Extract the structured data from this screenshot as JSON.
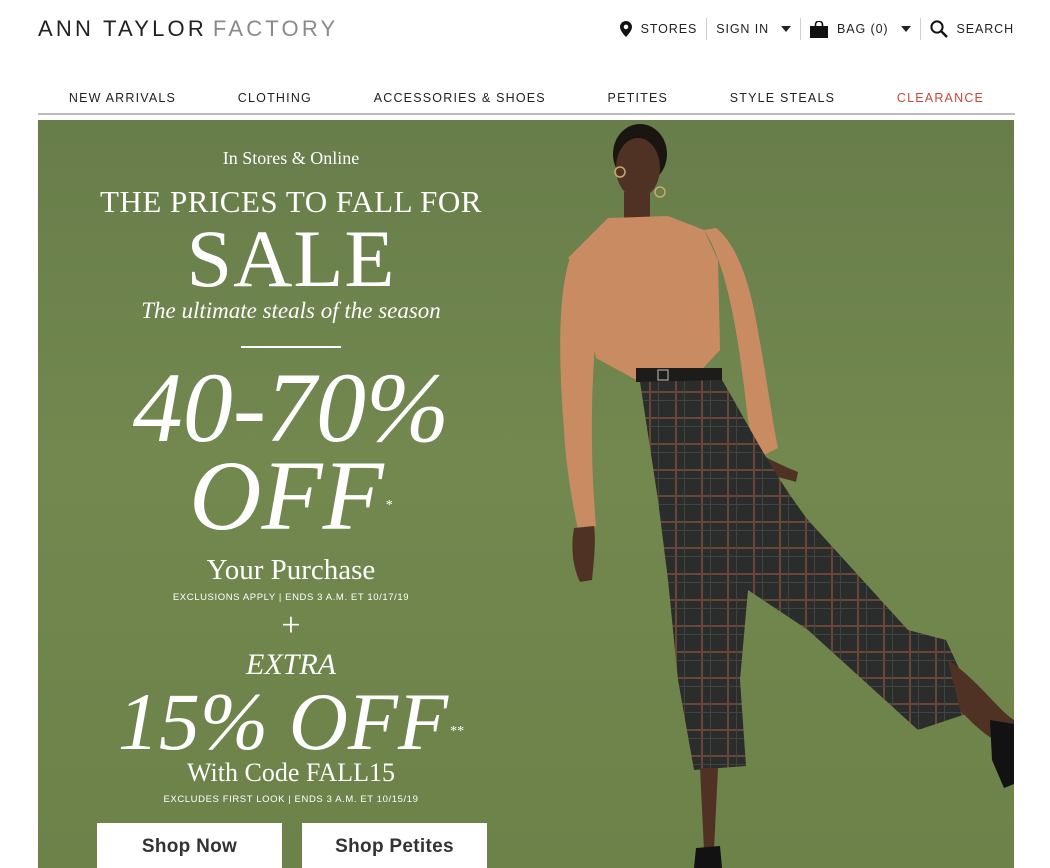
{
  "header": {
    "logo_primary": "ANN TAYLOR",
    "logo_secondary": "FACTORY",
    "utility": {
      "stores_label": "STORES",
      "sign_in_label": "SIGN IN",
      "bag_label": "BAG (0)",
      "search_label": "SEARCH"
    }
  },
  "nav": {
    "items": [
      {
        "label": "NEW ARRIVALS"
      },
      {
        "label": "CLOTHING"
      },
      {
        "label": "ACCESSORIES & SHOES"
      },
      {
        "label": "PETITES"
      },
      {
        "label": "STYLE STEALS"
      },
      {
        "label": "CLEARANCE"
      }
    ]
  },
  "hero": {
    "eyebrow": "In Stores & Online",
    "headline": "THE PRICES TO FALL FOR",
    "sale": "SALE",
    "tagline": "The ultimate steals of the season",
    "discount_range": "40-70%",
    "discount_off": "OFF",
    "discount_marker": "*",
    "your_purchase": "Your Purchase",
    "fine_print_1": "EXCLUSIONS APPLY | ENDS 3 A.M. ET 10/17/19",
    "plus": "+",
    "extra": "EXTRA",
    "extra_off": "15% OFF",
    "extra_marker": "**",
    "with_code": "With Code FALL15",
    "fine_print_2": "EXCLUDES FIRST LOOK | ENDS 3 A.M. ET 10/15/19",
    "cta_primary": "Shop Now",
    "cta_secondary": "Shop Petites"
  },
  "colors": {
    "hero_bg": "#6f854c",
    "clearance": "#c8473a",
    "text": "#222222"
  }
}
